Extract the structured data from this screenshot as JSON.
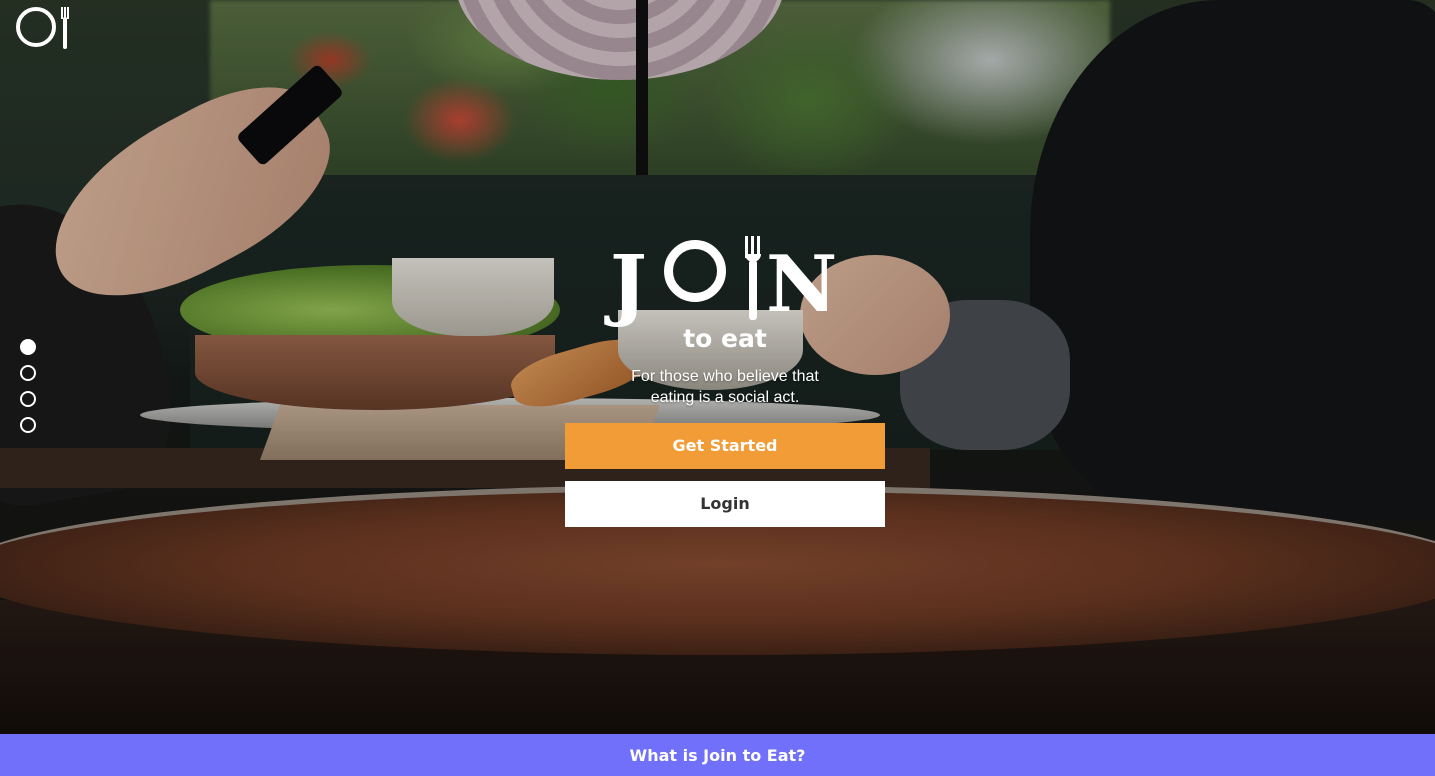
{
  "brand": {
    "logo_word_j": "J",
    "logo_word_n": "N",
    "logo_subtitle": "to eat",
    "logo_icon": "plate-and-fork-icon"
  },
  "hero": {
    "tagline_line1": "For those who believe that",
    "tagline_line2": "eating is a social act.",
    "primary_button": "Get Started",
    "secondary_button": "Login"
  },
  "slider": {
    "count": 4,
    "active_index": 0
  },
  "footer_bar": {
    "label": "What is Join to Eat?"
  },
  "colors": {
    "accent_orange": "#f29c38",
    "footer_purple": "#7070fb",
    "white": "#ffffff"
  }
}
